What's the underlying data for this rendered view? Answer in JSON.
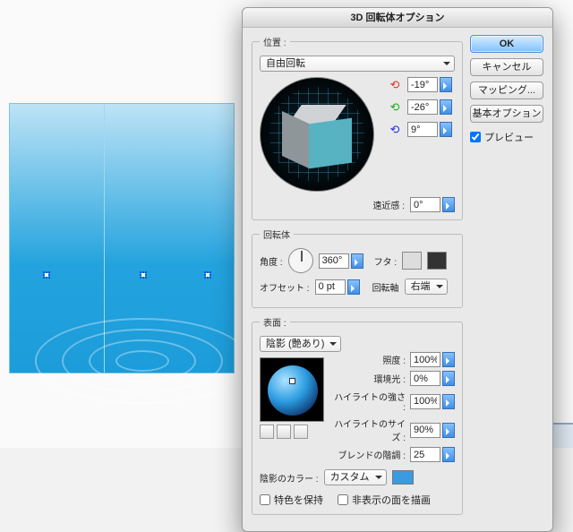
{
  "dialog": {
    "title": "3D 回転体オプション",
    "ok": "OK",
    "cancel": "キャンセル",
    "mapping": "マッピング...",
    "basic": "基本オプション",
    "preview": "プレビュー"
  },
  "position": {
    "legend": "位置 :",
    "preset": "自由回転",
    "rx": "-19°",
    "ry": "-26°",
    "rz": "9°",
    "perspective_label": "遠近感 :",
    "perspective": "0°"
  },
  "revolve": {
    "legend": "回転体",
    "angle_label": "角度 :",
    "angle": "360°",
    "cap_label": "フタ :",
    "offset_label": "オフセット :",
    "offset": "0 pt",
    "axis_label": "回転軸",
    "axis": "右端"
  },
  "surface": {
    "legend": "表面 :",
    "shading": "陰影 (艶あり)",
    "intensity_label": "照度 :",
    "intensity": "100%",
    "ambient_label": "環境光 :",
    "ambient": "0%",
    "highlight_label": "ハイライトの強さ :",
    "highlight": "100%",
    "hlsize_label": "ハイライトのサイズ :",
    "hlsize": "90%",
    "blend_label": "ブレンドの階調 :",
    "blend": "25",
    "shade_color_label": "陰影のカラー :",
    "shade_color": "カスタム"
  },
  "footer": {
    "preserve": "特色を保持",
    "hidden": "非表示の面を描画"
  }
}
